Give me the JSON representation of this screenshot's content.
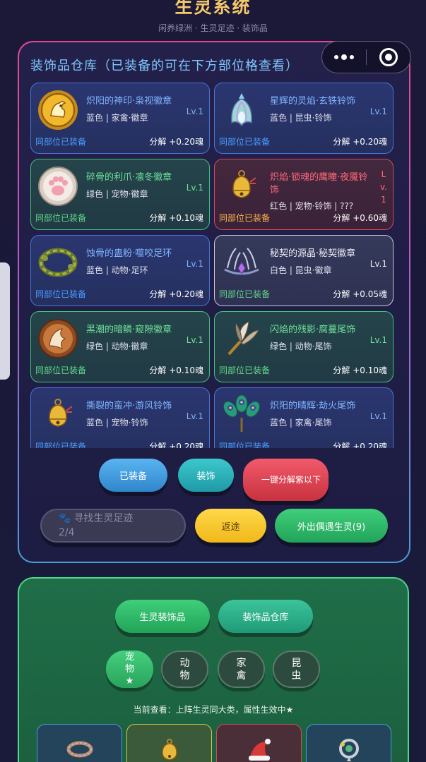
{
  "header": {
    "title": "生灵系统",
    "subtitle": "闲养绿洲 · 生灵足迹 · 装饰品"
  },
  "colors": {
    "accent_gold": "#f5c96a",
    "rare_blue": "#4a73d6",
    "green": "#3fc27a",
    "red": "#d64a5a",
    "white": "#c8c8d8"
  },
  "warehouse": {
    "title": "装饰品仓库（已装备的可在下方部位格查看）",
    "items": [
      {
        "name": "炽阳的神印·枭视徽章",
        "meta": "蓝色 | 家禽·徽章",
        "level": "Lv.1",
        "equipped": "同部位已装备",
        "decompose": "分解 +0.20魂",
        "rarity": "blue",
        "icon": "golden-rooster-badge-icon"
      },
      {
        "name": "星辉的灵焰·玄铁铃饰",
        "meta": "蓝色 | 昆虫·铃饰",
        "level": "Lv.1",
        "equipped": "同部位已装备",
        "decompose": "分解 +0.20魂",
        "rarity": "blue",
        "icon": "crystal-flower-bell-icon"
      },
      {
        "name": "碎骨的利爪·凛冬徽章",
        "meta": "绿色 | 宠物·徽章",
        "level": "Lv.1",
        "equipped": "同部位已装备",
        "decompose": "分解 +0.10魂",
        "rarity": "green",
        "icon": "paw-badge-icon"
      },
      {
        "name": "炽焰·锁魂的鹰瞳·夜魇铃饰",
        "meta": "红色 | 宠物·铃饰 | ???",
        "level": "Lv.1",
        "equipped": "同部位已装备",
        "decompose": "分解 +0.60魂",
        "rarity": "red",
        "icon": "golden-bell-icon"
      },
      {
        "name": "蚀骨的蛊粉·噬咬足环",
        "meta": "蓝色 | 动物·足环",
        "level": "Lv.1",
        "equipped": "同部位已装备",
        "decompose": "分解 +0.20魂",
        "rarity": "blue",
        "icon": "woven-ring-icon"
      },
      {
        "name": "秘契的源晶·秘契徽章",
        "meta": "白色 | 昆虫·徽章",
        "level": "Lv.1",
        "equipped": "同部位已装备",
        "decompose": "分解 +0.05魂",
        "rarity": "white",
        "icon": "tiara-icon"
      },
      {
        "name": "黑潮的暗鳞·窥隙徽章",
        "meta": "绿色 | 动物·徽章",
        "level": "Lv.1",
        "equipped": "同部位已装备",
        "decompose": "分解 +0.10魂",
        "rarity": "green",
        "icon": "fox-tail-badge-icon"
      },
      {
        "name": "闪焰的残影·腐蔓尾饰",
        "meta": "绿色 | 动物·尾饰",
        "level": "Lv.1",
        "equipped": "同部位已装备",
        "decompose": "分解 +0.10魂",
        "rarity": "green",
        "icon": "feather-tail-icon"
      },
      {
        "name": "撕裂的蛮冲·游风铃饰",
        "meta": "蓝色 | 宠物·铃饰",
        "level": "Lv.1",
        "equipped": "同部位已装备",
        "decompose": "分解 +0.20魂",
        "rarity": "blue",
        "icon": "golden-bell-icon"
      },
      {
        "name": "炽阳的晴辉·劫火尾饰",
        "meta": "蓝色 | 家禽·尾饰",
        "level": "Lv.1",
        "equipped": "同部位已装备",
        "decompose": "分解 +0.20魂",
        "rarity": "blue",
        "icon": "peacock-feather-icon"
      }
    ]
  },
  "actions": {
    "equipped": "已装备",
    "decor": "装饰",
    "onekey": "一键分解紫以下",
    "search": "寻找生灵足迹",
    "search_progress": "2/4",
    "return": "返途",
    "outing": "外出偶遇生灵(9)"
  },
  "lower_panel": {
    "decorations_btn": "生灵装饰品",
    "warehouse_btn": "装饰品仓库",
    "categories": [
      {
        "label": "宠物★",
        "active": true
      },
      {
        "label": "动物",
        "active": false
      },
      {
        "label": "家禽",
        "active": false
      },
      {
        "label": "昆虫",
        "active": false
      }
    ],
    "hint": "当前查看：上阵生灵同大类，属性生效中★",
    "slots": [
      {
        "icon": "collar-icon",
        "rarity": "blue"
      },
      {
        "icon": "golden-bell-icon",
        "rarity": "gold"
      },
      {
        "icon": "santa-hat-icon",
        "rarity": "red"
      },
      {
        "icon": "pendant-icon",
        "rarity": "blue"
      }
    ]
  }
}
